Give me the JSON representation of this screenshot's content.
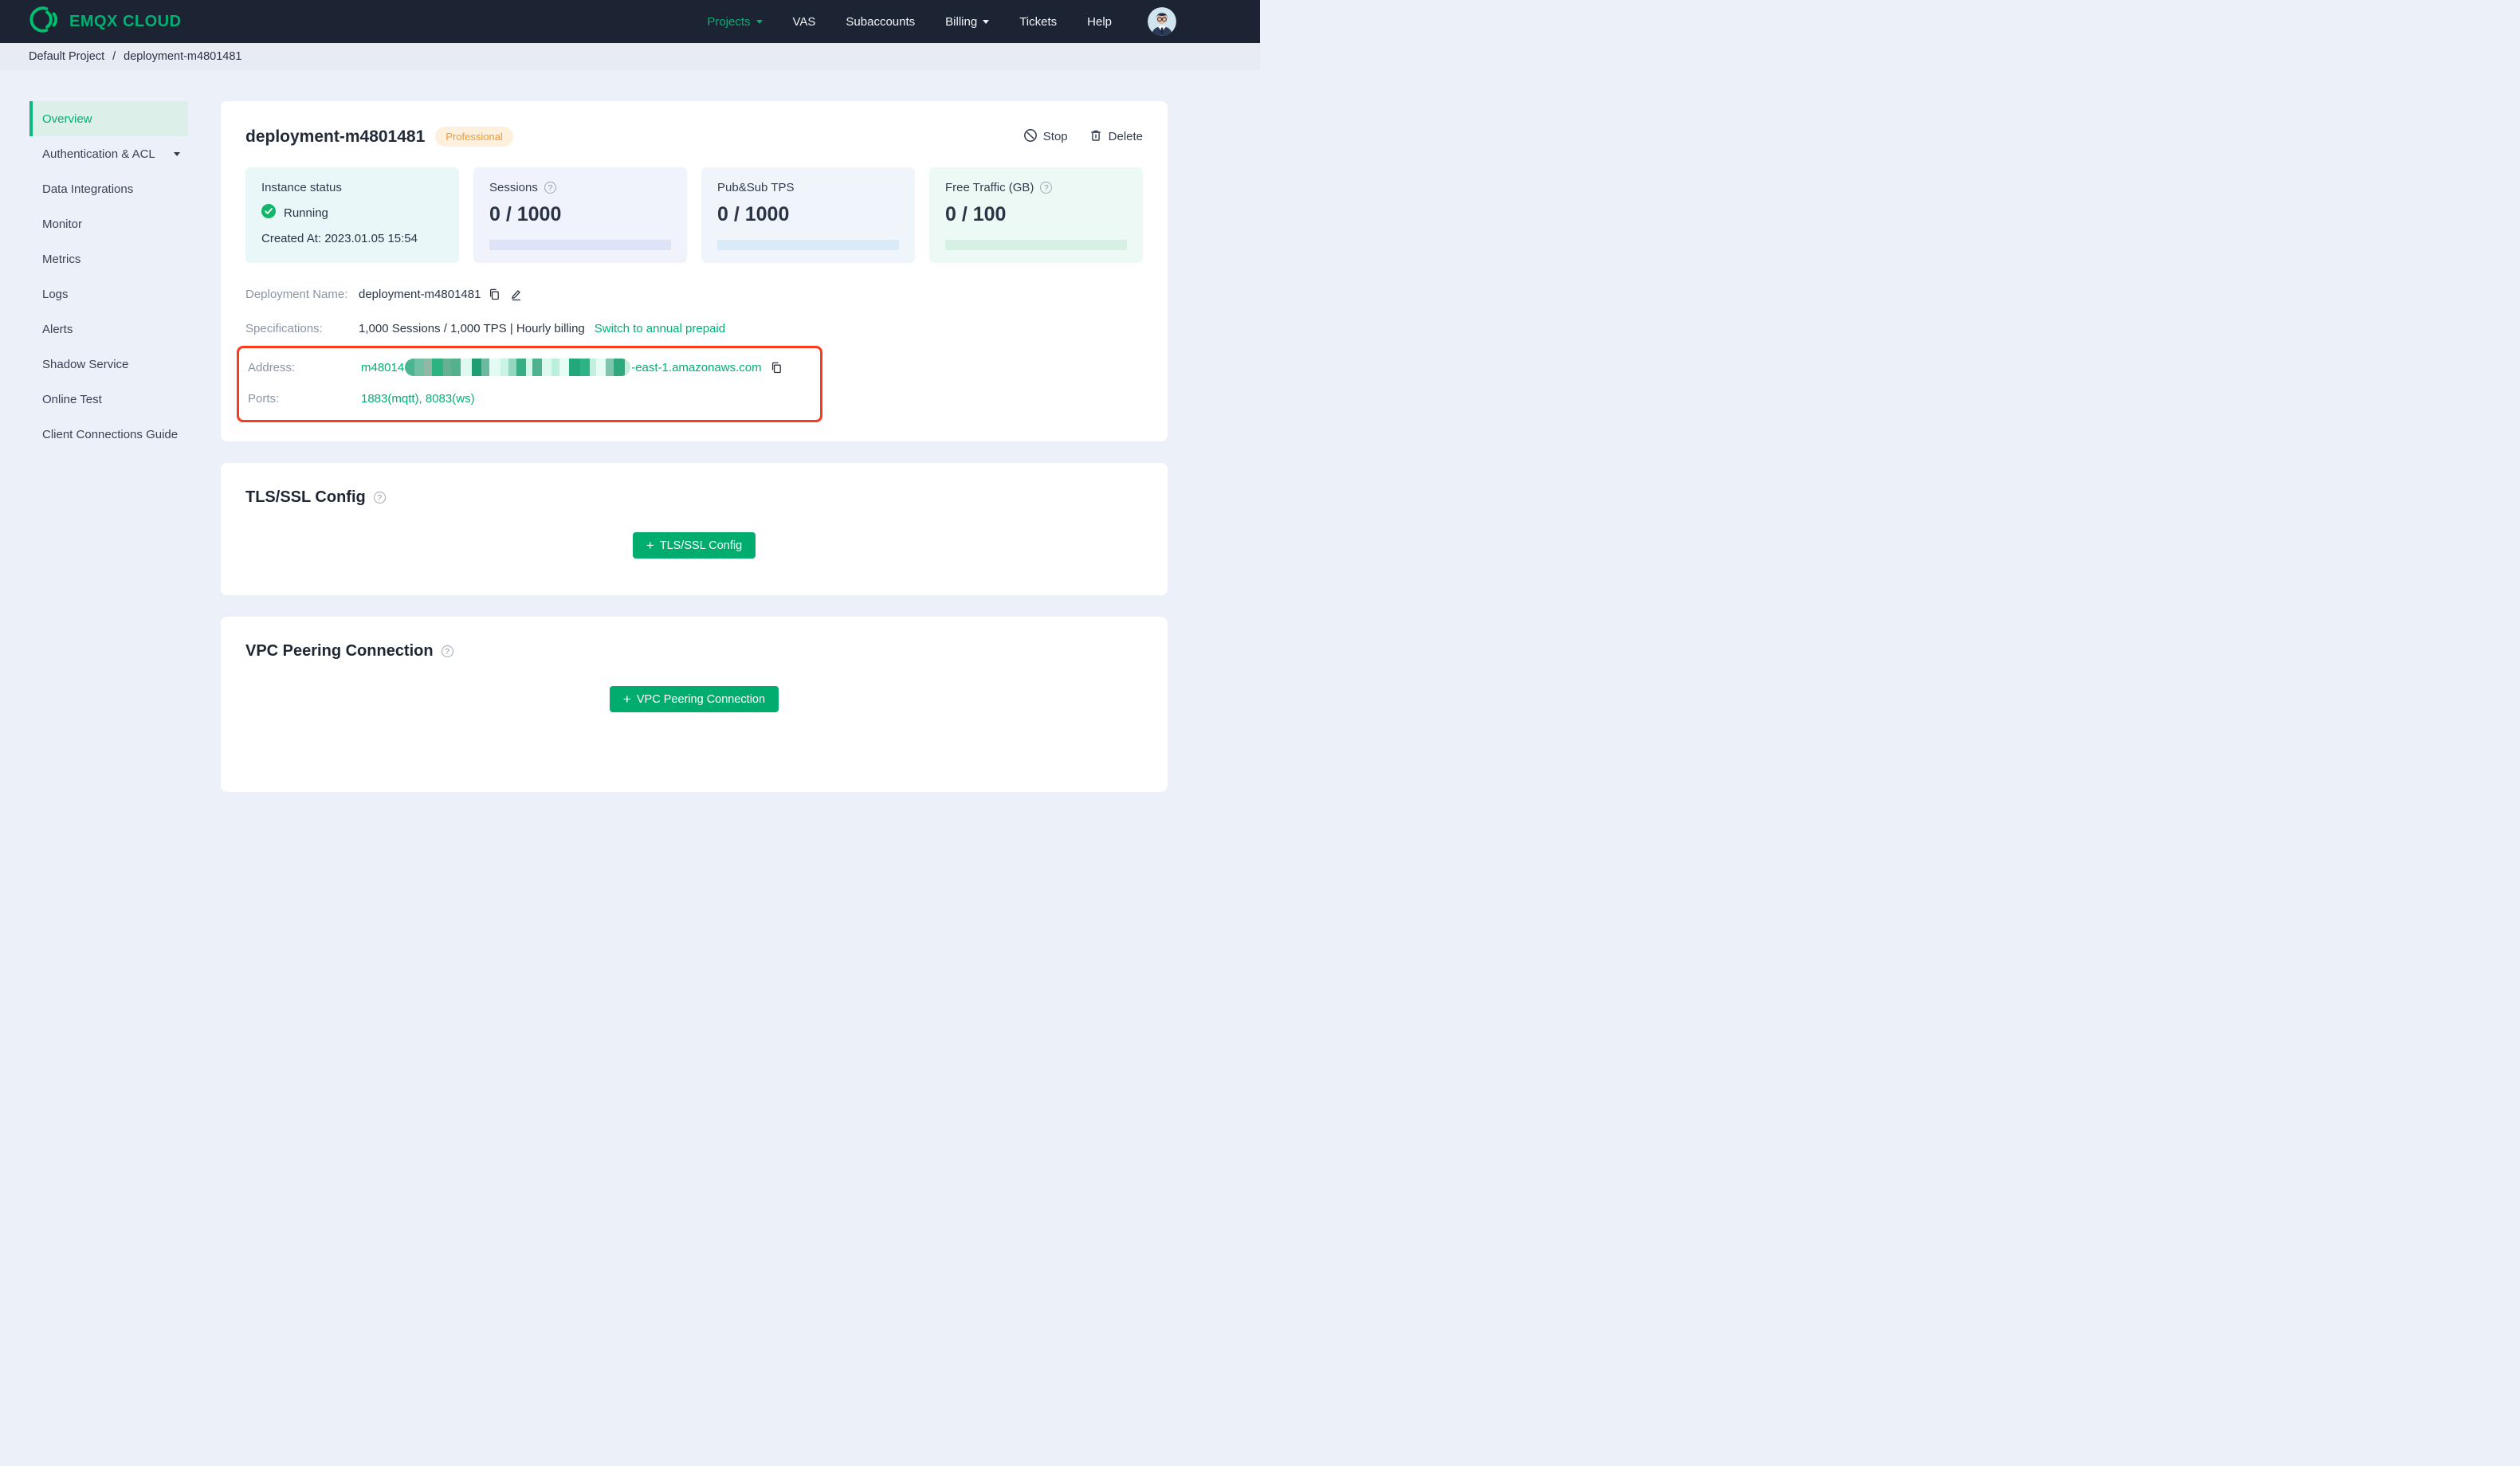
{
  "colors": {
    "nav-bg": "#1c2433",
    "accent": "#00b173",
    "accent-btn": "#00ad6e",
    "breadcrumb-bg": "#e7ebf4",
    "page-bg": "#ecf0f9",
    "sidebar-active-bg": "#ddefe9",
    "sidebar-active-bar": "#0cb87e",
    "text-dark": "#2b3444",
    "text-label": "#8b94a5",
    "badge-bg": "#fdf0dc",
    "badge-text": "#f09a38",
    "highlight-red": "#fb3a1c",
    "card-cyan-bg": "#e9f7f8",
    "card-lavender-bg": "#f0f2fc",
    "card-blue-bg": "#eff5fb",
    "card-mint-bg": "#edf9f4",
    "bar-lavender": "#dfe3f8",
    "bar-blue": "#d9ebf8",
    "bar-mint": "#d7f0e4",
    "status-green": "#12b76a",
    "logo-green": "#00c070"
  },
  "nav": {
    "brand": "EMQX CLOUD",
    "items": [
      {
        "label": "Projects"
      },
      {
        "label": "VAS"
      },
      {
        "label": "Subaccounts"
      },
      {
        "label": "Billing"
      },
      {
        "label": "Tickets"
      },
      {
        "label": "Help"
      }
    ]
  },
  "breadcrumb": {
    "project": "Default Project",
    "separator": "/",
    "current": "deployment-m4801481"
  },
  "sidebar": {
    "items": [
      {
        "label": "Overview"
      },
      {
        "label": "Authentication & ACL"
      },
      {
        "label": "Data Integrations"
      },
      {
        "label": "Monitor"
      },
      {
        "label": "Metrics"
      },
      {
        "label": "Logs"
      },
      {
        "label": "Alerts"
      },
      {
        "label": "Shadow Service"
      },
      {
        "label": "Online Test"
      },
      {
        "label": "Client Connections Guide"
      }
    ]
  },
  "overview": {
    "title": "deployment-m4801481",
    "badge": "Professional",
    "stop": "Stop",
    "delete": "Delete",
    "stats": {
      "instance": {
        "label": "Instance status",
        "status": "Running",
        "created": "Created At: 2023.01.05 15:54"
      },
      "sessions": {
        "label": "Sessions",
        "value": "0 / 1000"
      },
      "tps": {
        "label": "Pub&Sub TPS",
        "value": "0 / 1000"
      },
      "traffic": {
        "label": "Free Traffic (GB)",
        "value": "0 / 100"
      }
    },
    "details": {
      "name_label": "Deployment Name:",
      "name_value": "deployment-m4801481",
      "spec_label": "Specifications:",
      "spec_value": "1,000 Sessions / 1,000 TPS | Hourly billing",
      "spec_link": "Switch to annual prepaid",
      "address_label": "Address:",
      "address_prefix": "m48014",
      "address_suffix": "-east-1.amazonaws.com",
      "ports_label": "Ports:",
      "ports_value": "1883(mqtt), 8083(ws)"
    }
  },
  "sections": {
    "tls": {
      "title": "TLS/SSL Config",
      "button": "TLS/SSL Config"
    },
    "vpc": {
      "title": "VPC Peering Connection",
      "button": "VPC Peering Connection"
    }
  },
  "mosaic": {
    "stripes": [
      {
        "c": "#49b591",
        "w": 12
      },
      {
        "c": "#6fc0a5",
        "w": 12
      },
      {
        "c": "#8fb8a6",
        "w": 10
      },
      {
        "c": "#2cb381",
        "w": 14
      },
      {
        "c": "#66b096",
        "w": 10
      },
      {
        "c": "#55b18d",
        "w": 12
      },
      {
        "c": "#dff8f0",
        "w": 14
      },
      {
        "c": "#1f9e73",
        "w": 12
      },
      {
        "c": "#6cbaa0",
        "w": 10
      },
      {
        "c": "#e3fbf4",
        "w": 14
      },
      {
        "c": "#c9f3e4",
        "w": 10
      },
      {
        "c": "#93d7bf",
        "w": 10
      },
      {
        "c": "#37ae85",
        "w": 12
      },
      {
        "c": "#d7f6ea",
        "w": 8
      },
      {
        "c": "#4fb18d",
        "w": 12
      },
      {
        "c": "#dcf8ef",
        "w": 12
      },
      {
        "c": "#baefdc",
        "w": 10
      },
      {
        "c": "#e8fcf6",
        "w": 12
      },
      {
        "c": "#22a87b",
        "w": 14
      },
      {
        "c": "#2eb286",
        "w": 12
      },
      {
        "c": "#c3efdf",
        "w": 8
      },
      {
        "c": "#e6fbf4",
        "w": 12
      },
      {
        "c": "#7fc5ad",
        "w": 10
      },
      {
        "c": "#30a87e",
        "w": 14
      },
      {
        "c": "#bfeeda",
        "w": 7
      }
    ]
  }
}
